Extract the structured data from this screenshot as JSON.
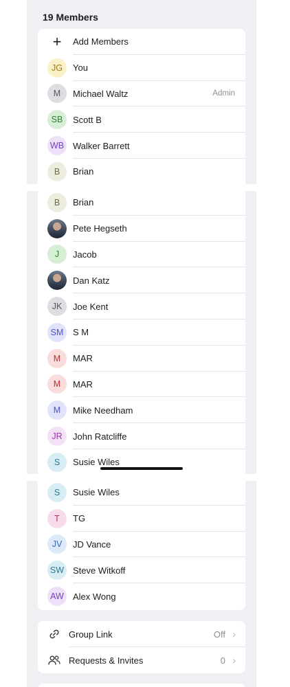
{
  "header": {
    "members_count": "19 Members"
  },
  "add_members_label": "Add Members",
  "admin_label": "Admin",
  "colors": {
    "panel_bg": "#efeff4",
    "card_bg": "#ffffff",
    "secondary_text": "#8e8e93"
  },
  "section1": [
    {
      "initials": "JG",
      "name": "You",
      "bg": "#fbf1c6",
      "fg": "#9a7a13"
    },
    {
      "initials": "M",
      "name": "Michael Waltz",
      "bg": "#dddde2",
      "fg": "#55555c",
      "admin": true
    },
    {
      "initials": "SB",
      "name": "Scott B",
      "bg": "#d7f0d5",
      "fg": "#2e7d32"
    },
    {
      "initials": "WB",
      "name": "Walker Barrett",
      "bg": "#ece1f8",
      "fg": "#7440b8"
    },
    {
      "initials": "B",
      "name": "Brian",
      "bg": "#ececdf",
      "fg": "#6b6b4c"
    }
  ],
  "section2": [
    {
      "initials": "B",
      "name": "Brian",
      "bg": "#ececdf",
      "fg": "#6b6b4c"
    },
    {
      "initials": "",
      "name": "Pete Hegseth",
      "photo": true
    },
    {
      "initials": "J",
      "name": "Jacob",
      "bg": "#d7f0d5",
      "fg": "#2e7d32"
    },
    {
      "initials": "",
      "name": "Dan Katz",
      "photo": true
    },
    {
      "initials": "JK",
      "name": "Joe Kent",
      "bg": "#dddde2",
      "fg": "#55555c"
    },
    {
      "initials": "SM",
      "name": "S M",
      "bg": "#e1e3fb",
      "fg": "#4b52c4"
    },
    {
      "initials": "M",
      "name": "MAR",
      "bg": "#f9dcdc",
      "fg": "#b33131"
    },
    {
      "initials": "M",
      "name": "MAR",
      "bg": "#f9dcdc",
      "fg": "#b33131"
    },
    {
      "initials": "M",
      "name": "Mike Needham",
      "bg": "#e1e3fb",
      "fg": "#4b52c4"
    },
    {
      "initials": "JR",
      "name": "John Ratcliffe",
      "bg": "#f4e0f7",
      "fg": "#9b36ad"
    },
    {
      "initials": "S",
      "name": "Susie Wiles",
      "bg": "#d8ecf3",
      "fg": "#2b7a94"
    }
  ],
  "section3": [
    {
      "initials": "S",
      "name": "Susie Wiles",
      "bg": "#d8ecf3",
      "fg": "#2b7a94"
    },
    {
      "initials": "T",
      "name": "TG",
      "bg": "#f9dcec",
      "fg": "#b3306f"
    },
    {
      "initials": "JV",
      "name": "JD Vance",
      "bg": "#dde9fb",
      "fg": "#3a66b8"
    },
    {
      "initials": "SW",
      "name": "Steve Witkoff",
      "bg": "#d8ecf3",
      "fg": "#2b7a94"
    },
    {
      "initials": "AW",
      "name": "Alex Wong",
      "bg": "#ece1f8",
      "fg": "#7440b8"
    }
  ],
  "links": {
    "group_link": {
      "label": "Group Link",
      "value": "Off",
      "icon": "link-icon"
    },
    "requests": {
      "label": "Requests & Invites",
      "value": "0",
      "icon": "group-people-icon"
    }
  }
}
